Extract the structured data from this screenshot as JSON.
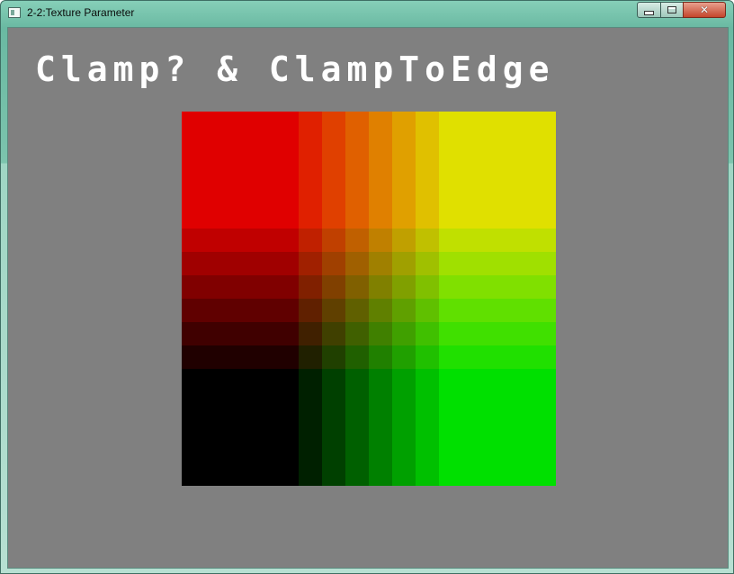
{
  "window": {
    "title": "2-2:Texture Parameter",
    "controls": {
      "minimize": "minimize-icon",
      "maximize": "maximize-icon",
      "close": "close-icon"
    }
  },
  "scene": {
    "heading": "Clamp? & ClampToEdge",
    "background_color": "#808080",
    "texture": {
      "description": "8x8 RG gradient texture, clamped to edge",
      "corner_colors": {
        "top_left": "#e00000",
        "top_right": "#e0e000",
        "bottom_left": "#000000",
        "bottom_right": "#00e000"
      },
      "levels": [
        224,
        192,
        160,
        128,
        96,
        64,
        32,
        0
      ]
    }
  }
}
